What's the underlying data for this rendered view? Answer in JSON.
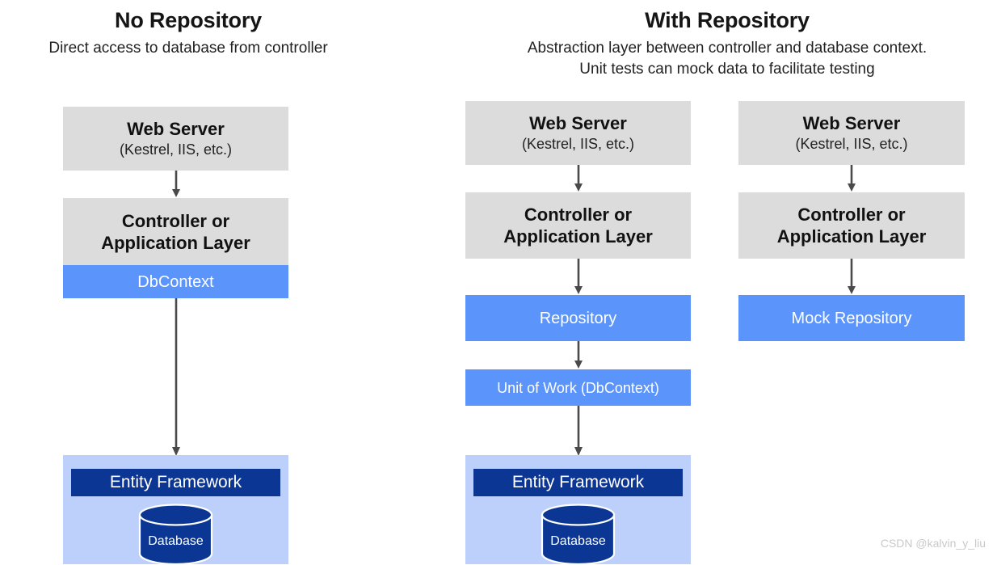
{
  "columns": [
    {
      "id": "no-repository",
      "title": "No Repository",
      "subtitle_line1": "Direct access to database from controller",
      "subtitle_line2": ""
    },
    {
      "id": "with-repository",
      "title": "With Repository",
      "subtitle_line1": "Abstraction layer between controller and database context.",
      "subtitle_line2": "Unit tests can mock data to facilitate testing"
    }
  ],
  "stacks": {
    "left": {
      "web_server_title": "Web Server",
      "web_server_sub": "(Kestrel, IIS, etc.)",
      "controller_line1": "Controller or",
      "controller_line2": "Application Layer",
      "dbcontext": "DbContext",
      "entity_framework": "Entity Framework",
      "database": "Database"
    },
    "middle": {
      "web_server_title": "Web Server",
      "web_server_sub": "(Kestrel, IIS, etc.)",
      "controller_line1": "Controller or",
      "controller_line2": "Application Layer",
      "repository": "Repository",
      "unit_of_work": "Unit of Work (DbContext)",
      "entity_framework": "Entity Framework",
      "database": "Database"
    },
    "right": {
      "web_server_title": "Web Server",
      "web_server_sub": "(Kestrel, IIS, etc.)",
      "controller_line1": "Controller or",
      "controller_line2": "Application Layer",
      "mock_repository": "Mock Repository"
    }
  },
  "colors": {
    "gray_box": "#dcdcdc",
    "blue_box": "#5b94fb",
    "light_blue_panel": "#bdd0fb",
    "dark_blue_band": "#0b3694",
    "arrow": "#4a4a4a",
    "title_text": "#151515",
    "watermark_text": "#c9c9c9"
  },
  "watermark": "CSDN @kalvin_y_liu"
}
